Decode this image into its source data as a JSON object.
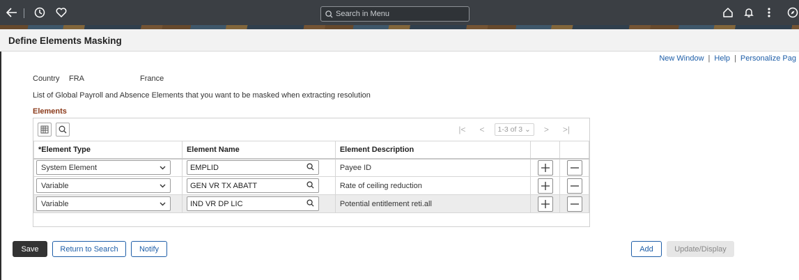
{
  "header": {
    "search_placeholder": "Search in Menu",
    "icons": [
      "back-arrow-icon",
      "history-icon",
      "favorites-heart-icon",
      "search-icon",
      "home-icon",
      "notification-bell-icon",
      "more-actions-icon",
      "navbar-compass-icon"
    ]
  },
  "page": {
    "title": "Define Elements Masking",
    "links": {
      "new_window": "New Window",
      "help": "Help",
      "personalize": "Personalize Pag",
      "sep": "|"
    },
    "country": {
      "label": "Country",
      "code": "FRA",
      "name": "France"
    },
    "description": "List of Global Payroll and Absence Elements that you want to be masked when extracting resolution"
  },
  "grid": {
    "title": "Elements",
    "pager": {
      "first": "|<",
      "prev": "<",
      "count": "1-3 of 3",
      "next": ">",
      "last": ">|"
    },
    "columns": {
      "type": "Element Type",
      "type_required": "*",
      "name": "Element Name",
      "desc": "Element Description"
    },
    "rows": [
      {
        "type": "System Element",
        "name": "EMPLID",
        "desc": "Payee ID"
      },
      {
        "type": "Variable",
        "name": "GEN VR TX ABATT",
        "desc": "Rate of ceiling reduction"
      },
      {
        "type": "Variable",
        "name": "IND VR DP LIC",
        "desc": "Potential entitlement reti.all"
      }
    ]
  },
  "buttons": {
    "save": "Save",
    "return_to_search": "Return to Search",
    "notify": "Notify",
    "add": "Add",
    "update_display": "Update/Display"
  },
  "colors": {
    "header_bg": "#3b3f44",
    "link": "#1e5ea8",
    "grid_title": "#8b3a1a",
    "primary_button": "#333333"
  }
}
